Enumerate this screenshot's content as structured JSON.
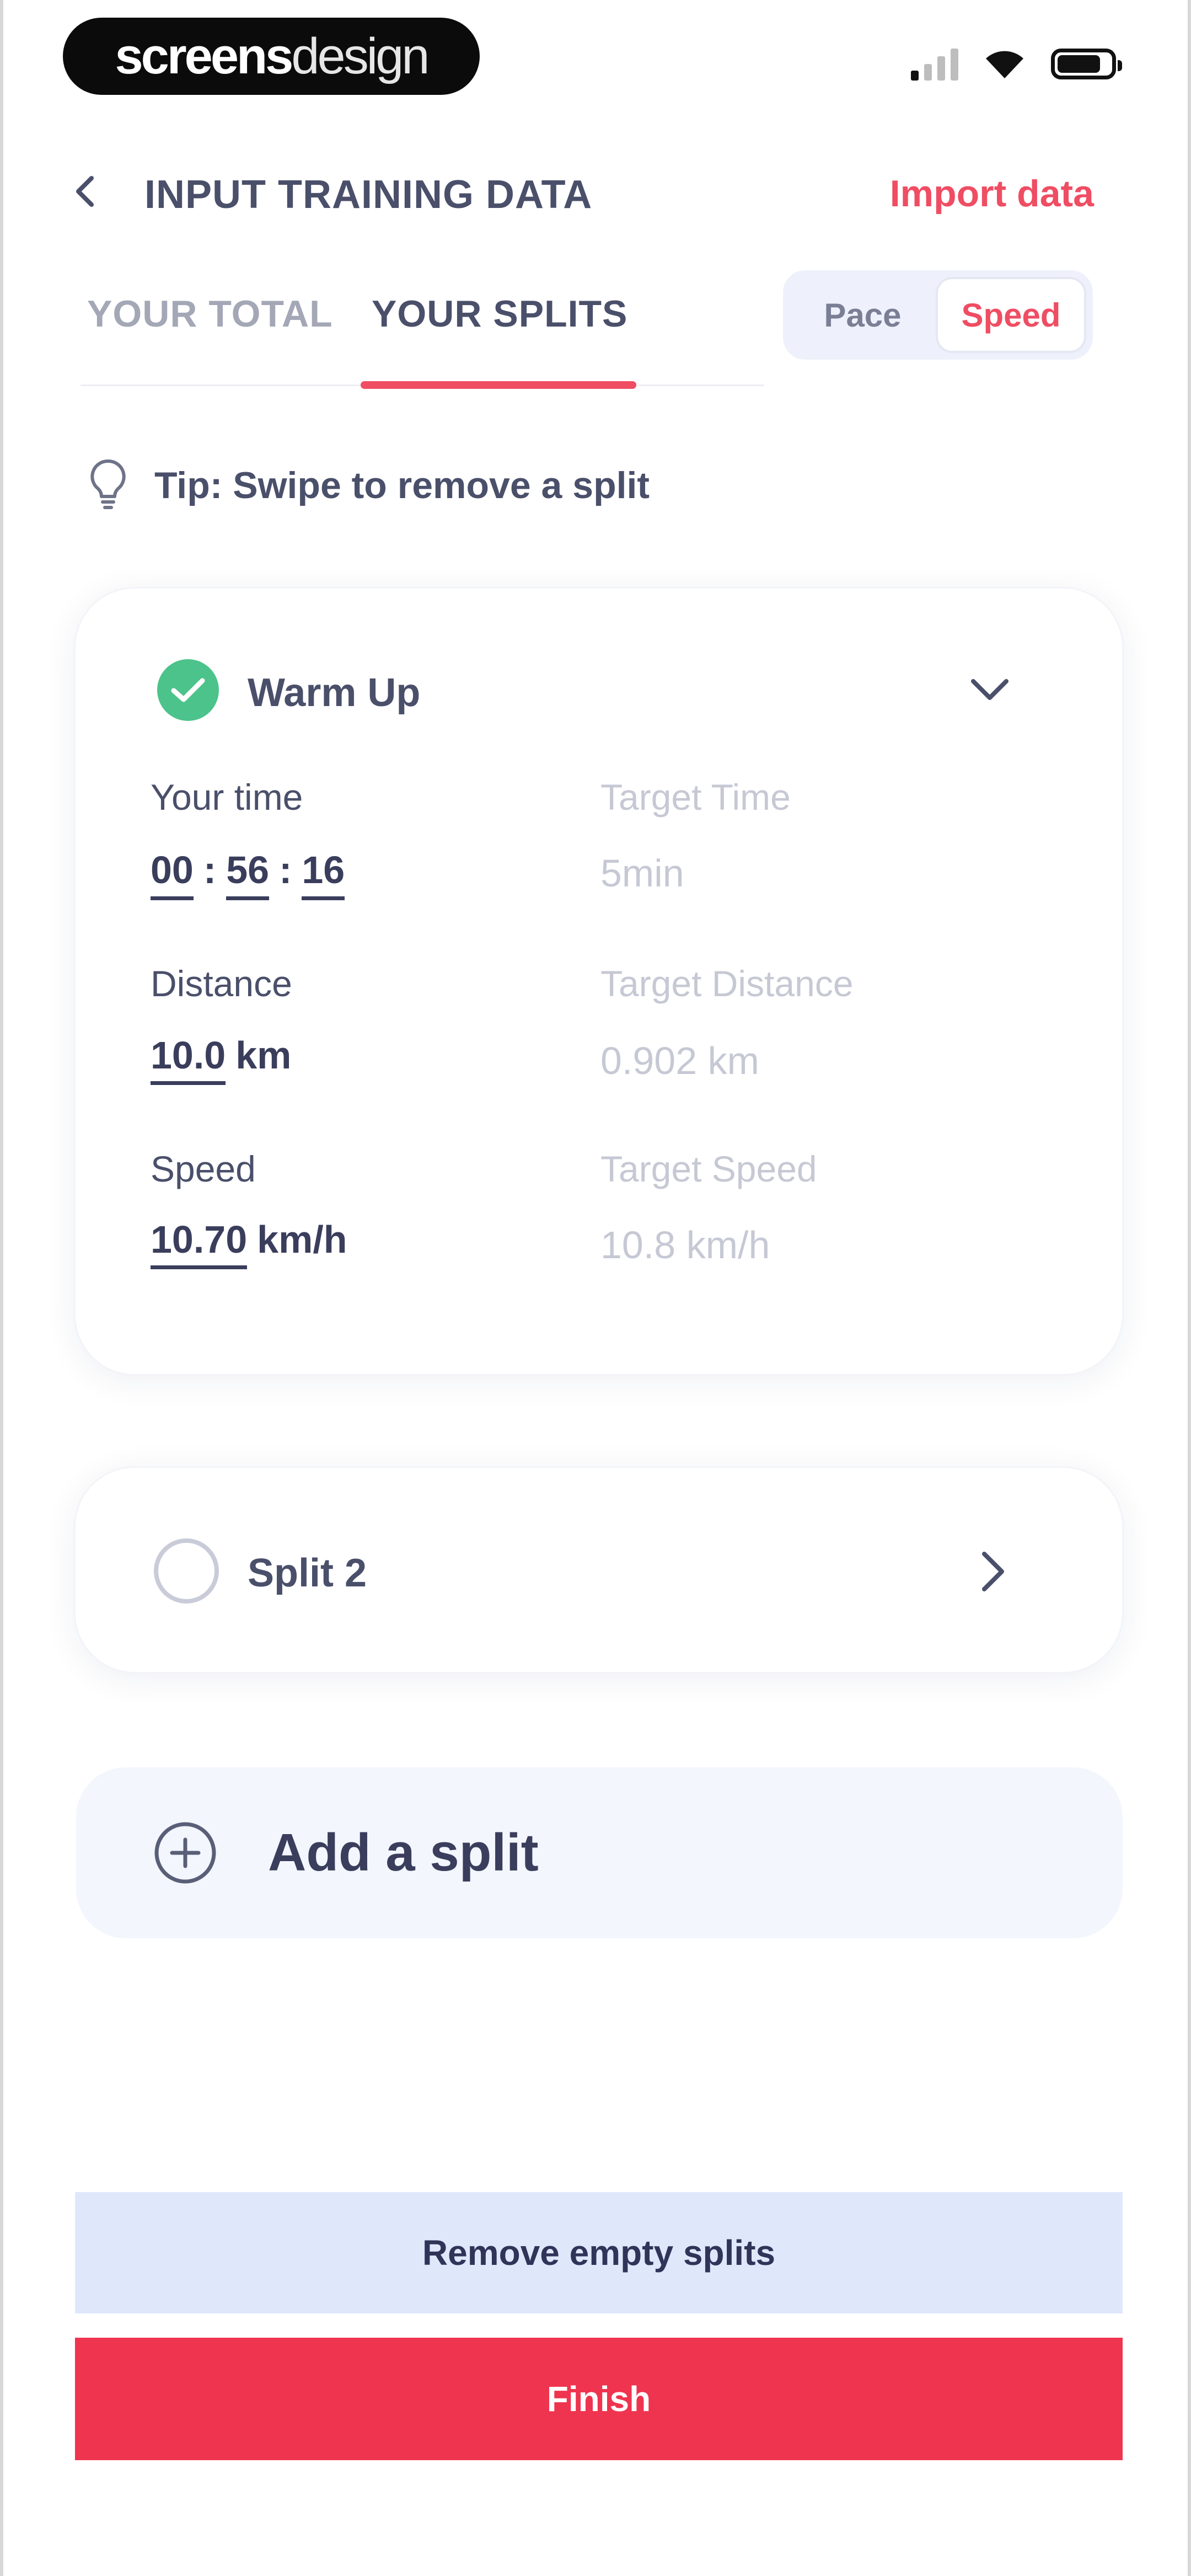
{
  "status_bar": {
    "brand_bold": "screens",
    "brand_light": "design",
    "signal_icon": "cellular-signal-icon",
    "wifi_icon": "wifi-icon",
    "battery_icon": "battery-icon"
  },
  "header": {
    "back_icon": "chevron-left-icon",
    "title": "INPUT TRAINING DATA",
    "import_label": "Import data"
  },
  "tabs": [
    {
      "label": "YOUR TOTAL",
      "active": false
    },
    {
      "label": "YOUR SPLITS",
      "active": true
    }
  ],
  "toggle": {
    "options": [
      "Pace",
      "Speed"
    ],
    "selected": "Speed"
  },
  "tip": {
    "icon": "lightbulb-icon",
    "text": "Tip: Swipe to remove a split"
  },
  "splits": [
    {
      "title": "Warm Up",
      "completed": true,
      "expanded": true,
      "your_time_label": "Your time",
      "time": {
        "hh": "00",
        "mm": "56",
        "ss": "16"
      },
      "time_sep": ":",
      "target_time_label": "Target Time",
      "target_time": "5min",
      "distance_label": "Distance",
      "distance_value": "10.0",
      "distance_unit": "km",
      "target_distance_label": "Target Distance",
      "target_distance": "0.902 km",
      "speed_label": "Speed",
      "speed_value": "10.70",
      "speed_unit": "km/h",
      "target_speed_label": "Target Speed",
      "target_speed": "10.8 km/h"
    },
    {
      "title": "Split 2",
      "completed": false,
      "expanded": false
    }
  ],
  "add_split": {
    "icon": "plus-circle-icon",
    "label": "Add a split"
  },
  "actions": {
    "remove_empty_label": "Remove empty splits",
    "finish_label": "Finish"
  },
  "colors": {
    "accent": "#ef4d63",
    "finish_button": "#ef344f",
    "success": "#4cc38a",
    "secondary_button": "#dfe8fb",
    "text_dark": "#3a3e5c"
  }
}
